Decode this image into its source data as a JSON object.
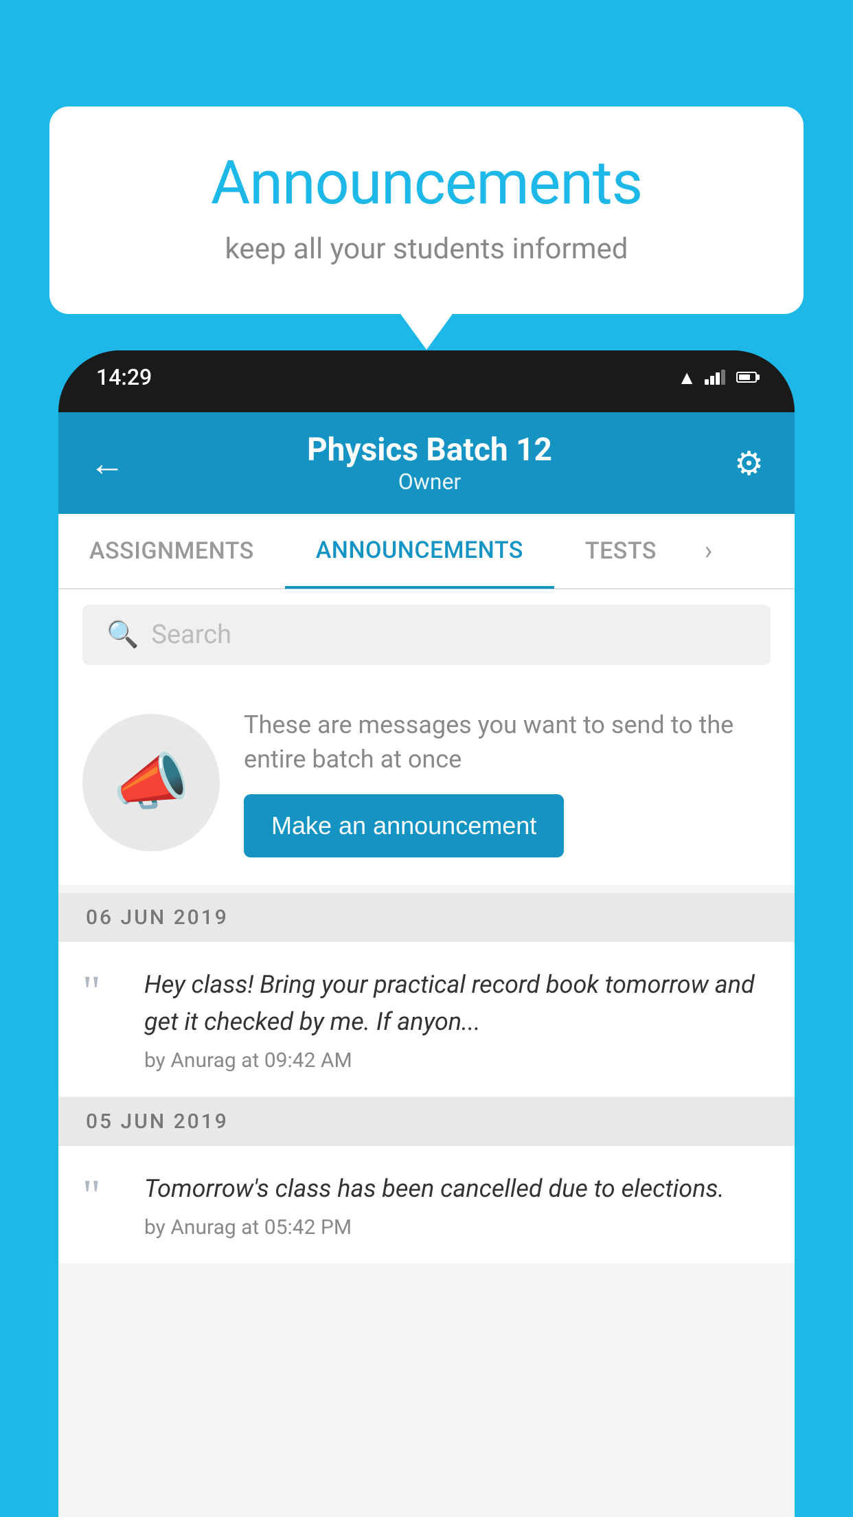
{
  "background_color": "#1DB8E8",
  "speech_bubble": {
    "title": "Announcements",
    "subtitle": "keep all your students informed"
  },
  "phone": {
    "status_bar": {
      "time": "14:29"
    },
    "app_bar": {
      "title": "Physics Batch 12",
      "subtitle": "Owner",
      "back_label": "←",
      "settings_label": "⚙"
    },
    "tabs": [
      {
        "label": "ASSIGNMENTS",
        "active": false
      },
      {
        "label": "ANNOUNCEMENTS",
        "active": true
      },
      {
        "label": "TESTS",
        "active": false
      }
    ],
    "search": {
      "placeholder": "Search"
    },
    "promo": {
      "text": "These are messages you want to send to the entire batch at once",
      "button_label": "Make an announcement"
    },
    "announcements": [
      {
        "date": "06  JUN  2019",
        "items": [
          {
            "text": "Hey class! Bring your practical record book tomorrow and get it checked by me. If anyon...",
            "meta": "by Anurag at 09:42 AM"
          }
        ]
      },
      {
        "date": "05  JUN  2019",
        "items": [
          {
            "text": "Tomorrow's class has been cancelled due to elections.",
            "meta": "by Anurag at 05:42 PM"
          }
        ]
      }
    ]
  }
}
